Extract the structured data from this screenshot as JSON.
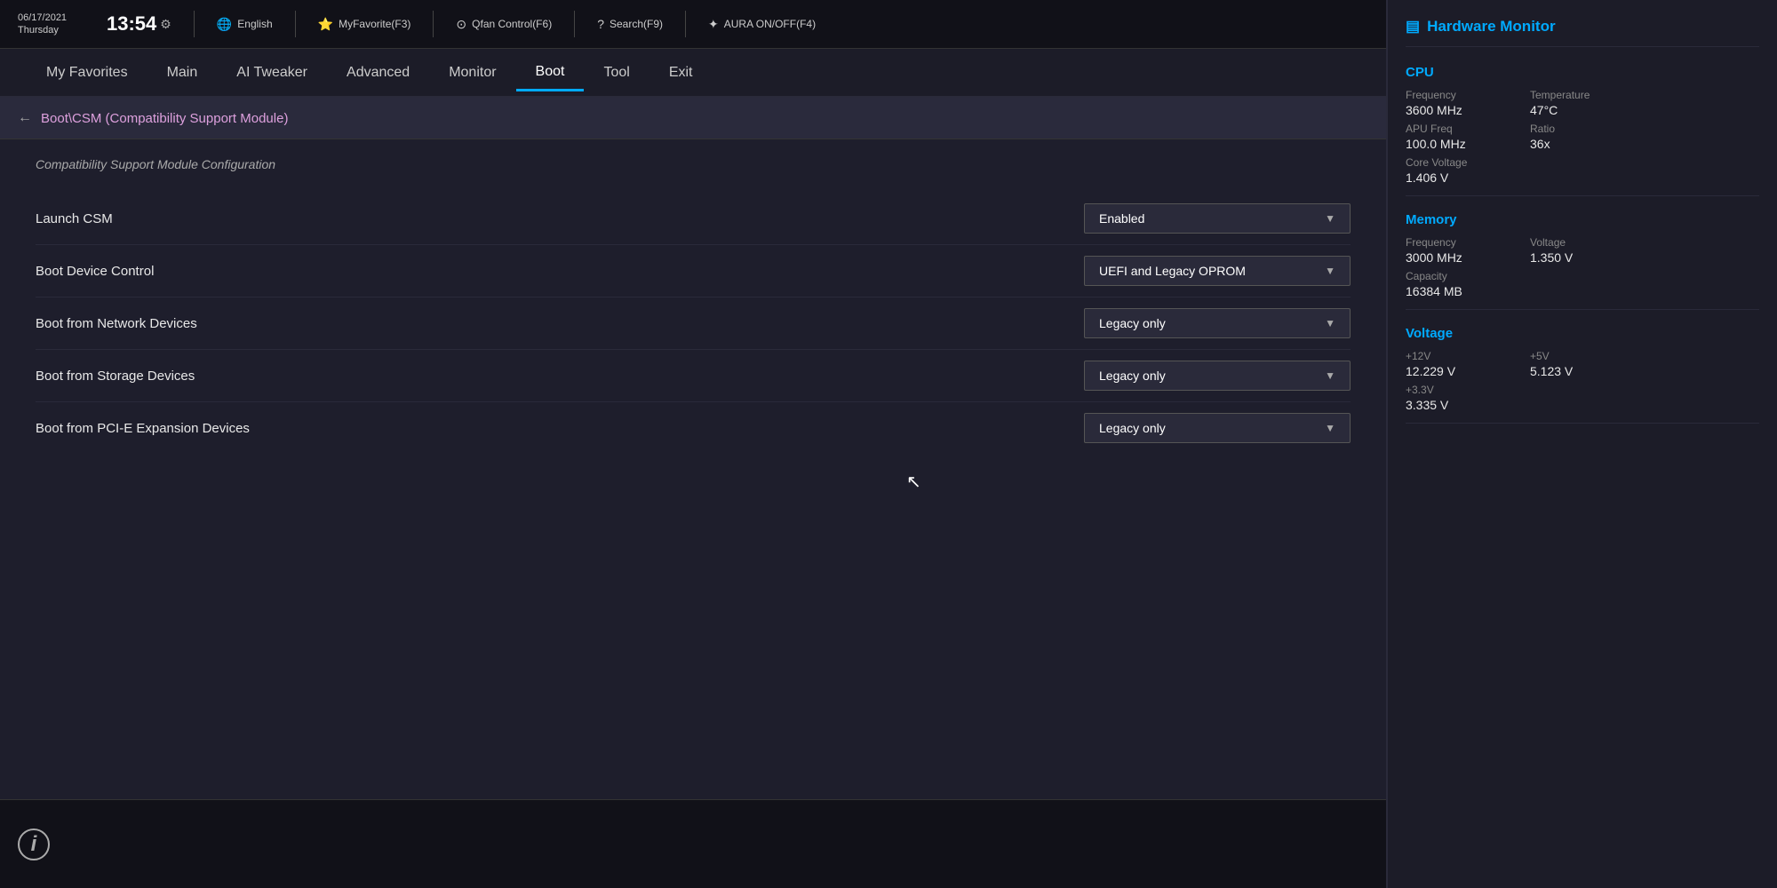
{
  "statusbar": {
    "date": "06/17/2021",
    "day": "Thursday",
    "time": "13:54",
    "gear": "⚙",
    "items": [
      {
        "icon": "🌐",
        "label": "English"
      },
      {
        "icon": "☆",
        "label": "MyFavorite(F3)"
      },
      {
        "icon": "⟳",
        "label": "Qfan Control(F6)"
      },
      {
        "icon": "?",
        "label": "Search(F9)"
      },
      {
        "icon": "✦",
        "label": "AURA ON/OFF(F4)"
      }
    ]
  },
  "nav": {
    "items": [
      {
        "id": "my-favorites",
        "label": "My Favorites",
        "active": false
      },
      {
        "id": "main",
        "label": "Main",
        "active": false
      },
      {
        "id": "ai-tweaker",
        "label": "AI Tweaker",
        "active": false
      },
      {
        "id": "advanced",
        "label": "Advanced",
        "active": false
      },
      {
        "id": "monitor",
        "label": "Monitor",
        "active": false
      },
      {
        "id": "boot",
        "label": "Boot",
        "active": true
      },
      {
        "id": "tool",
        "label": "Tool",
        "active": false
      },
      {
        "id": "exit",
        "label": "Exit",
        "active": false
      }
    ]
  },
  "breadcrumb": {
    "back_arrow": "←",
    "path": "Boot\\CSM (Compatibility Support Module)"
  },
  "section": {
    "title": "Compatibility Support Module Configuration",
    "settings": [
      {
        "id": "launch-csm",
        "label": "Launch CSM",
        "value": "Enabled"
      },
      {
        "id": "boot-device-control",
        "label": "Boot Device Control",
        "value": "UEFI and Legacy OPROM"
      },
      {
        "id": "boot-from-network",
        "label": "Boot from Network Devices",
        "value": "Legacy only"
      },
      {
        "id": "boot-from-storage",
        "label": "Boot from Storage Devices",
        "value": "Legacy only"
      },
      {
        "id": "boot-from-pcie",
        "label": "Boot from PCI-E Expansion Devices",
        "value": "Legacy only"
      }
    ]
  },
  "hw_monitor": {
    "title": "Hardware Monitor",
    "icon": "▤",
    "sections": [
      {
        "id": "cpu",
        "title": "CPU",
        "rows": [
          [
            {
              "label": "Frequency",
              "value": "3600 MHz"
            },
            {
              "label": "Temperature",
              "value": "47°C"
            }
          ],
          [
            {
              "label": "APU Freq",
              "value": "100.0 MHz"
            },
            {
              "label": "Ratio",
              "value": "36x"
            }
          ],
          [
            {
              "label": "Core Voltage",
              "value": "1.406 V"
            }
          ]
        ]
      },
      {
        "id": "memory",
        "title": "Memory",
        "rows": [
          [
            {
              "label": "Frequency",
              "value": "3000 MHz"
            },
            {
              "label": "Voltage",
              "value": "1.350 V"
            }
          ],
          [
            {
              "label": "Capacity",
              "value": "16384 MB"
            }
          ]
        ]
      },
      {
        "id": "voltage",
        "title": "Voltage",
        "rows": [
          [
            {
              "label": "+12V",
              "value": "12.229 V"
            },
            {
              "label": "+5V",
              "value": "5.123 V"
            }
          ],
          [
            {
              "label": "+3.3V",
              "value": "3.335 V"
            }
          ]
        ]
      }
    ]
  },
  "info_icon": "i"
}
